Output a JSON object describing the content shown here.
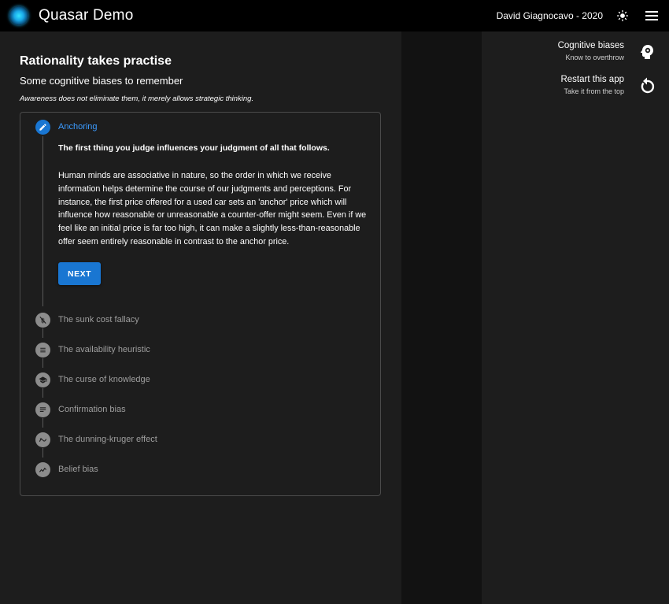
{
  "header": {
    "title": "Quasar Demo",
    "author": "David Giagnocavo - 2020",
    "icons": {
      "theme": "sun-icon",
      "menu": "hamburger-menu-icon"
    }
  },
  "page": {
    "title": "Rationality takes practise",
    "subtitle": "Some cognitive biases to remember",
    "note": "Awareness does not eliminate them, it merely allows strategic thinking."
  },
  "stepper": {
    "active": {
      "title": "Anchoring",
      "icon": "edit-icon",
      "headline": "The first thing you judge influences your judgment of all that follows.",
      "body": "Human minds are associative in nature, so the order in which we receive information helps determine the course of our judgments and perceptions. For instance, the first price offered for a used car sets an 'anchor' price which will influence how reasonable or unreasonable a counter-offer might seem. Even if we feel like an initial price is far too high, it can make a slightly less-than-reasonable offer seem entirely reasonable in contrast to the anchor price.",
      "next_label": "NEXT"
    },
    "steps": [
      {
        "title": "The sunk cost fallacy",
        "icon": "money-off-icon"
      },
      {
        "title": "The availability heuristic",
        "icon": "list-icon"
      },
      {
        "title": "The curse of knowledge",
        "icon": "school-icon"
      },
      {
        "title": "Confirmation bias",
        "icon": "notes-icon"
      },
      {
        "title": "The dunning-kruger effect",
        "icon": "trending-icon"
      },
      {
        "title": "Belief bias",
        "icon": "chart-line-icon"
      }
    ]
  },
  "drawer": {
    "items": [
      {
        "label": "Cognitive biases",
        "caption": "Know to overthrow",
        "icon": "psychology-icon"
      },
      {
        "label": "Restart this app",
        "caption": "Take it from the top",
        "icon": "restart-icon"
      }
    ]
  },
  "colors": {
    "header_bg": "#000000",
    "page_bg": "#1d1d1d",
    "primary": "#1976d2",
    "active_step_title": "#3b9bff",
    "inactive_step": "#9e9e9e"
  }
}
